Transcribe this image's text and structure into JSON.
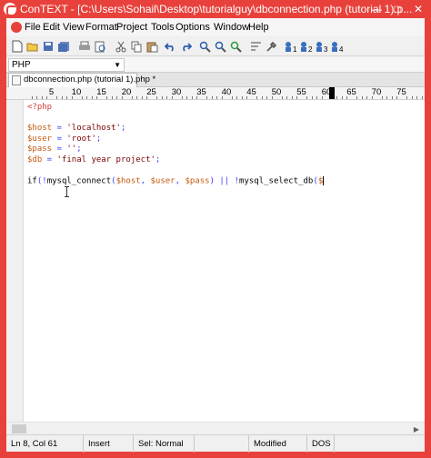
{
  "window": {
    "title": "ConTEXT - [C:\\Users\\Sohail\\Desktop\\tutorialguy\\dbconnection.php (tutorial 1).p...",
    "minimize": "—",
    "maximize": "□",
    "close": "✕"
  },
  "menu": {
    "items": [
      "File",
      "Edit",
      "View",
      "Format",
      "Project",
      "Tools",
      "Options",
      "Window",
      "Help"
    ]
  },
  "toolbar": {
    "icons": [
      "new-file-icon",
      "open-folder-icon",
      "save-icon",
      "save-all-icon",
      "print-icon",
      "print-preview-icon",
      "cut-icon",
      "copy-icon",
      "paste-icon",
      "undo-icon",
      "redo-icon",
      "find-icon",
      "find-next-icon",
      "replace-icon",
      "word-wrap-icon",
      "tools-icon",
      "user-exec-1-icon",
      "user-exec-2-icon",
      "user-exec-3-icon",
      "user-exec-4-icon"
    ]
  },
  "highlighter": {
    "selected": "PHP"
  },
  "tabs": [
    {
      "label": "dbconnection.php (tutorial 1).php *"
    }
  ],
  "ruler": {
    "numbers": [
      "5",
      "10",
      "15",
      "20",
      "25",
      "30",
      "35",
      "40",
      "45",
      "50",
      "55",
      "60",
      "65",
      "70",
      "75"
    ],
    "cursor_column": 61
  },
  "editor": {
    "lines": [
      [
        {
          "t": "<?php",
          "c": "tag"
        }
      ],
      [],
      [
        {
          "t": "$host",
          "c": "var"
        },
        {
          "t": " = ",
          "c": "op"
        },
        {
          "t": "'localhost'",
          "c": "str"
        },
        {
          "t": ";",
          "c": "op"
        }
      ],
      [
        {
          "t": "$user",
          "c": "var"
        },
        {
          "t": " = ",
          "c": "op"
        },
        {
          "t": "'root'",
          "c": "str"
        },
        {
          "t": ";",
          "c": "op"
        }
      ],
      [
        {
          "t": "$pass",
          "c": "var"
        },
        {
          "t": " = ",
          "c": "op"
        },
        {
          "t": "''",
          "c": "str"
        },
        {
          "t": ";",
          "c": "op"
        }
      ],
      [
        {
          "t": "$db",
          "c": "var"
        },
        {
          "t": " = ",
          "c": "op"
        },
        {
          "t": "'final year project'",
          "c": "str"
        },
        {
          "t": ";",
          "c": "op"
        }
      ],
      [],
      [
        {
          "t": "if",
          "c": "plain"
        },
        {
          "t": "(!",
          "c": "op"
        },
        {
          "t": "mysql_connect",
          "c": "plain"
        },
        {
          "t": "(",
          "c": "op"
        },
        {
          "t": "$host",
          "c": "var"
        },
        {
          "t": ", ",
          "c": "op"
        },
        {
          "t": "$user",
          "c": "var"
        },
        {
          "t": ", ",
          "c": "op"
        },
        {
          "t": "$pass",
          "c": "var"
        },
        {
          "t": ") || !",
          "c": "op"
        },
        {
          "t": "mysql_select_db",
          "c": "plain"
        },
        {
          "t": "(",
          "c": "op"
        },
        {
          "t": "$",
          "c": "var"
        }
      ]
    ],
    "caret_line": 8,
    "colors": {
      "plain": "#000000",
      "var": "#c55a10",
      "str": "#7a0000",
      "op": "#3c3cff",
      "tag": "#d43e3e"
    }
  },
  "status": {
    "position": "Ln 8, Col 61",
    "mode": "Insert",
    "selection": "Sel: Normal",
    "blank": "",
    "modified": "Modified",
    "format": "DOS"
  },
  "colors": {
    "title_bar": "#e8413c",
    "chrome": "#f0f0f0"
  }
}
